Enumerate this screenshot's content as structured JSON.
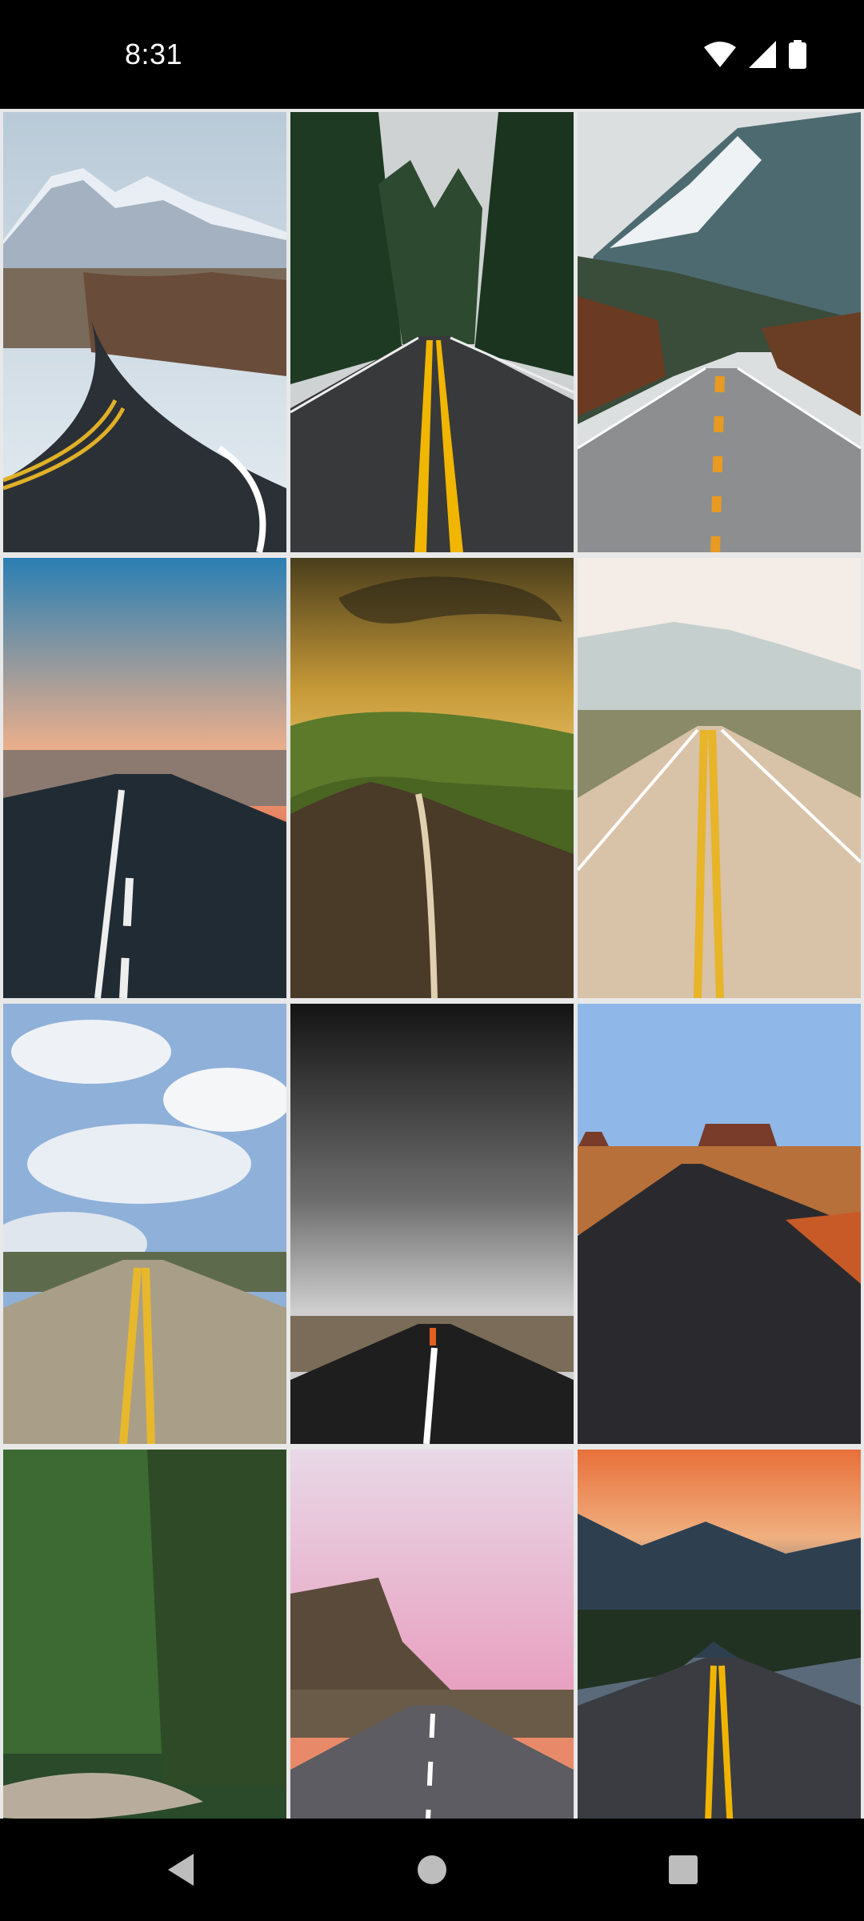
{
  "status_bar": {
    "time": "8:31",
    "icons": [
      "wifi-icon",
      "cellular-signal-icon",
      "battery-icon"
    ]
  },
  "gallery": {
    "items": [
      {
        "name": "snowy-mountain-curve-road"
      },
      {
        "name": "forest-road-yellow-lines"
      },
      {
        "name": "mountain-valley-highway"
      },
      {
        "name": "sunset-coastal-road"
      },
      {
        "name": "golden-hills-road"
      },
      {
        "name": "desert-rolling-highway"
      },
      {
        "name": "cloudy-sky-straight-road"
      },
      {
        "name": "storm-clouds-runner-road"
      },
      {
        "name": "monument-valley-road"
      },
      {
        "name": "winding-forest-road"
      },
      {
        "name": "pink-sky-cliff-road"
      },
      {
        "name": "mountain-sunset-highway"
      }
    ]
  },
  "nav_bar": {
    "buttons": [
      "back-button",
      "home-button",
      "recents-button"
    ]
  },
  "colors": {
    "status_bar": "#000000",
    "grid_gap": "#e8e8e8",
    "nav_bar": "#000000"
  }
}
